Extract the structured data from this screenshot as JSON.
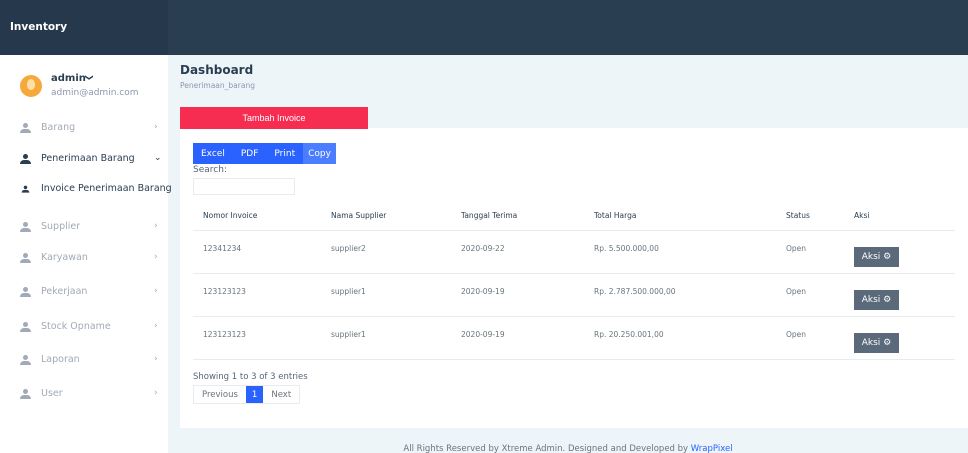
{
  "app": {
    "brand": "Inventory"
  },
  "profile": {
    "name": "admin",
    "caret": "❯",
    "email": "admin@admin.com"
  },
  "sidebar": {
    "items": [
      {
        "label": "Barang",
        "chevron": "›"
      },
      {
        "label": "Penerimaan Barang",
        "chevron": "⌄"
      },
      {
        "label": "Invoice Penerimaan Barang"
      },
      {
        "label": "Supplier",
        "chevron": "›"
      },
      {
        "label": "Karyawan",
        "chevron": "›"
      },
      {
        "label": "Pekerjaan",
        "chevron": "›"
      },
      {
        "label": "Stock Opname",
        "chevron": "›"
      },
      {
        "label": "Laporan",
        "chevron": "›"
      },
      {
        "label": "User",
        "chevron": "›"
      }
    ]
  },
  "page": {
    "title": "Dashboard",
    "subtitle": "Penerimaan_barang"
  },
  "actions": {
    "add_invoice": "Tambah Invoice"
  },
  "export": {
    "excel": "Excel",
    "pdf": "PDF",
    "print": "Print",
    "copy": "Copy"
  },
  "search": {
    "label": "Search:",
    "value": ""
  },
  "table": {
    "headers": [
      "Nomor Invoice",
      "Nama Supplier",
      "Tanggal Terima",
      "Total Harga",
      "Status",
      "Aksi"
    ],
    "rows": [
      {
        "invoice": "12341234",
        "supplier": "supplier2",
        "date": "2020-09-22",
        "total": "Rp. 5.500.000,00",
        "status": "Open",
        "action": "Aksi"
      },
      {
        "invoice": "123123123",
        "supplier": "supplier1",
        "date": "2020-09-19",
        "total": "Rp. 2.787.500.000,00",
        "status": "Open",
        "action": "Aksi"
      },
      {
        "invoice": "123123123",
        "supplier": "supplier1",
        "date": "2020-09-19",
        "total": "Rp. 20.250.001,00",
        "status": "Open",
        "action": "Aksi"
      }
    ]
  },
  "pagination": {
    "info": "Showing 1 to 3 of 3 entries",
    "previous": "Previous",
    "current": "1",
    "next": "Next"
  },
  "footer": {
    "text": "All Rights Reserved by Xtreme Admin. Designed and Developed by ",
    "link": "WrapPixel"
  },
  "colors": {
    "topbar": "#2a3e52",
    "danger": "#f62d51",
    "primary": "#2962ff",
    "action_button": "#5b6a7a",
    "background": "#eef5f9"
  },
  "icons": {
    "menu": "user-icon",
    "settings": "gear-icon"
  }
}
